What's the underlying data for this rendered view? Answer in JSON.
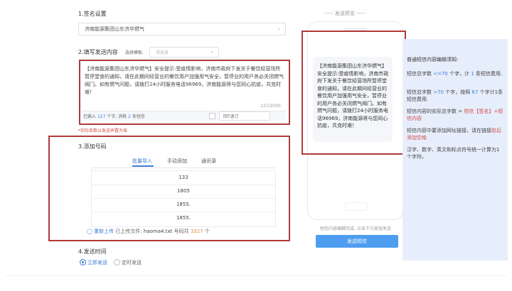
{
  "step1": {
    "title": "1.签名设置",
    "signature": "济南能源集团山东济华燃气"
  },
  "step2": {
    "title": "2.填写发送内容",
    "template_label": "选择模板:",
    "template_placeholder": "请选择",
    "content": "【济南能源集团山东济华燃气】安全提示:受疫情影响，济南市政府下发关于餐饮经营场所暂停堂食的通知，请在此期间经营业的餐饮用户加强用气安全，暂停业的用户务必关闭燃气阀门。如有燃气问题，请拨打24小时服务电话96969，济南能源将与您同心抗疫，共克时艰！",
    "counter": "127/2000",
    "stats_prefix": "已输入",
    "chars": "127",
    "stats_mid": "个字, 消耗",
    "msgs": "2",
    "stats_suffix": "条短信",
    "unsubscribe": "回T退订",
    "warning": "*实际条数以发送声置为准"
  },
  "step3": {
    "title": "3.添加号码",
    "tabs": [
      "批量导入",
      "手动添加",
      "通讯录"
    ],
    "numbers": [
      "133",
      "1805",
      "1855.",
      "1855."
    ],
    "reupload": "重新上传",
    "uploaded_prefix": "已上传文件:",
    "filename": "haoma4.txt",
    "count_prefix": "号码共",
    "count": "3327",
    "count_suffix": "个"
  },
  "step4": {
    "title": "4.发送时间",
    "options": [
      "立即发送",
      "定时发送"
    ]
  },
  "preview": {
    "title": "----- 发送预览 -----",
    "sms": "【济南能源集团山东济华燃气】安全提示:受疫情影响，济南市政府下发关于餐饮经营场所暂停堂食的通知，请在此期间经营业的餐饮用户加强用气安全，暂停业的用户务必关闭燃气阀门。如有燃气问题，请拨打24小时服务电话96969，济南能源将与您同心抗疫，共克时艰！",
    "hint": "短信内容编辑完成, 点击下方按钮发送",
    "send_button": "发送短信"
  },
  "rules": {
    "title": "普通短信内容编辑须知:",
    "r1a": "短信总字数",
    "r1b": "<=70",
    "r1c": "个字，计",
    "r1d": "1",
    "r1e": "条短信费用.",
    "r2a": "短信总字数",
    "r2b": ">70",
    "r2c": "个字，按照",
    "r2d": "67",
    "r2e": "个字计1条短信费用.",
    "r3a": "短信内容的实际总字数 =",
    "r3b": "短信【签名】+短信内容",
    "r4a": "短信内容中要添加网址链接，请在链接",
    "r4b": "前后添加空格",
    "r5": "汉字、数字、英文和标点符号统一计算为1个字符。"
  }
}
